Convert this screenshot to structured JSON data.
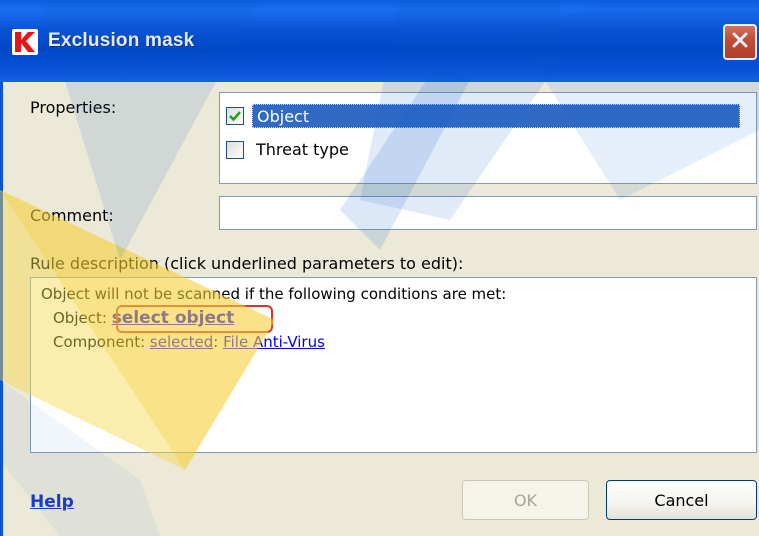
{
  "window": {
    "title": "Exclusion mask",
    "close_icon": "close-x-icon",
    "logo_icon": "kaspersky-k-icon"
  },
  "properties": {
    "label": "Properties:",
    "items": [
      {
        "label": "Object",
        "checked": true,
        "selected": true
      },
      {
        "label": "Threat type",
        "checked": false,
        "selected": false
      }
    ]
  },
  "comment": {
    "label": "Comment:",
    "value": ""
  },
  "rule": {
    "label": "Rule description (click underlined parameters to edit):",
    "intro": "Object will not be scanned if the following conditions are met:",
    "object_prefix": "Object:",
    "object_link": "select object",
    "component_prefix": "Component:",
    "component_selected_link": "selected",
    "component_separator": ":",
    "component_value_link": "File Anti-Virus"
  },
  "footer": {
    "help_label": "Help",
    "ok_label": "OK",
    "cancel_label": "Cancel"
  },
  "colors": {
    "titlebar": "#0b53d6",
    "dialog_bg": "#ece9d8",
    "selection": "#316ac5",
    "link": "#0000ee",
    "highlight": "#e03030"
  }
}
